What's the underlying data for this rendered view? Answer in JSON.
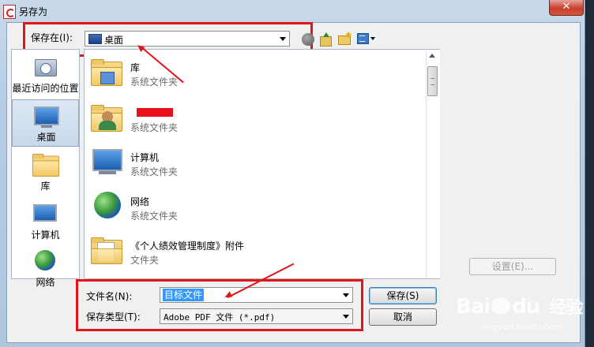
{
  "window": {
    "title": "另存为",
    "close_symbol": "✕"
  },
  "toolbar": {
    "save_in_label": "保存在(I):",
    "location_value": "桌面"
  },
  "places": [
    {
      "label": "最近访问的位置",
      "icon": "recent-places-icon"
    },
    {
      "label": "桌面",
      "icon": "desktop-icon",
      "selected": true
    },
    {
      "label": "库",
      "icon": "libraries-icon"
    },
    {
      "label": "计算机",
      "icon": "computer-icon"
    },
    {
      "label": "网络",
      "icon": "network-icon"
    }
  ],
  "files": [
    {
      "name": "库",
      "type": "系统文件夹",
      "icon": "libraries-folder-icon"
    },
    {
      "name": "",
      "type": "系统文件夹",
      "icon": "user-folder-icon",
      "redacted": true
    },
    {
      "name": "计算机",
      "type": "系统文件夹",
      "icon": "computer-icon"
    },
    {
      "name": "网络",
      "type": "系统文件夹",
      "icon": "network-icon"
    },
    {
      "name": "《个人绩效管理制度》附件",
      "type": "文件夹",
      "icon": "folder-icon"
    }
  ],
  "buttons": {
    "settings": "设置(E)...",
    "save": "保存(S)",
    "cancel": "取消"
  },
  "fields": {
    "filename_label": "文件名(N):",
    "filename_value": "目标文件",
    "filetype_label": "保存类型(T):",
    "filetype_value": "Adobe PDF 文件 (*.pdf)"
  },
  "watermark": {
    "brand_a": "Bai",
    "brand_b": "du",
    "brand_cn": "经验",
    "url": "jingyan.baidu.com"
  },
  "colors": {
    "highlight_red": "#e0161b",
    "selection_blue": "#3399ff",
    "close_red": "#c7402d"
  }
}
